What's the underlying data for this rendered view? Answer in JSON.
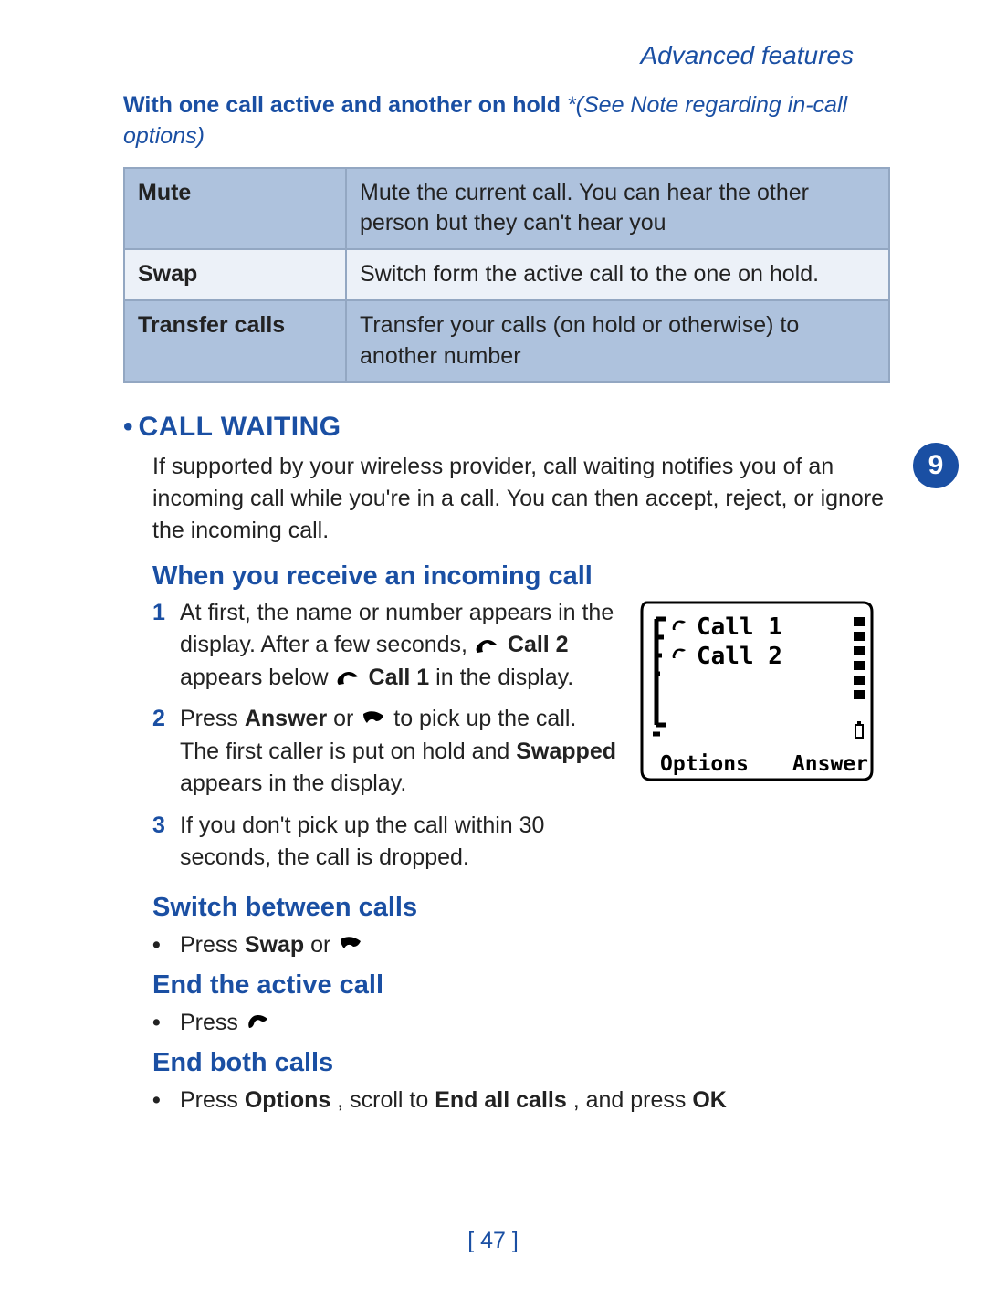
{
  "header": {
    "section": "Advanced features"
  },
  "intro": {
    "bold": "With one call active and another on hold",
    "note": "*(See Note regarding in-call options)"
  },
  "table": {
    "rows": [
      {
        "left": "Mute",
        "right": "Mute the current call. You can hear the other person but they can't hear you"
      },
      {
        "left": "Swap",
        "right": "Switch form the active call to the one on hold."
      },
      {
        "left": "Transfer calls",
        "right": "Transfer your calls (on hold or otherwise) to another number"
      }
    ]
  },
  "section": {
    "title": "CALL WAITING",
    "para": "If supported by your wireless provider, call waiting notifies you of an incoming call while you're in a call. You can then accept, reject, or ignore the incoming call."
  },
  "incoming": {
    "heading": "When you receive an incoming call",
    "items": [
      {
        "num": "1",
        "pre1": "At first, the name or number appears in the display. After a few seconds, ",
        "b1": "Call 2",
        "mid": " appears below ",
        "b2": "Call 1",
        "post": " in the display."
      },
      {
        "num": "2",
        "pre1": "Press ",
        "b1": "Answer",
        "mid": " or ",
        "post": " to pick up the call.",
        "line2_pre": "The first caller is put on hold and ",
        "line2_b": "Swapped",
        "line2_post": " appears in the display."
      },
      {
        "num": "3",
        "text": "If you don't pick up the call within 30 seconds, the call is dropped."
      }
    ]
  },
  "switch": {
    "heading": "Switch between calls",
    "item_pre": "Press ",
    "item_b": "Swap",
    "item_mid": " or "
  },
  "end_active": {
    "heading": "End the active call",
    "item_pre": "Press "
  },
  "end_both": {
    "heading": "End both calls",
    "item_pre": "Press ",
    "b1": "Options",
    "mid1": ", scroll to ",
    "b2": "End all calls",
    "mid2": ", and press ",
    "b3": "OK"
  },
  "phone": {
    "call1": "Call 1",
    "call2": "Call 2",
    "options": "Options",
    "answer": "Answer"
  },
  "tab": {
    "chapter": "9"
  },
  "footer": {
    "page": "[ 47 ]"
  }
}
